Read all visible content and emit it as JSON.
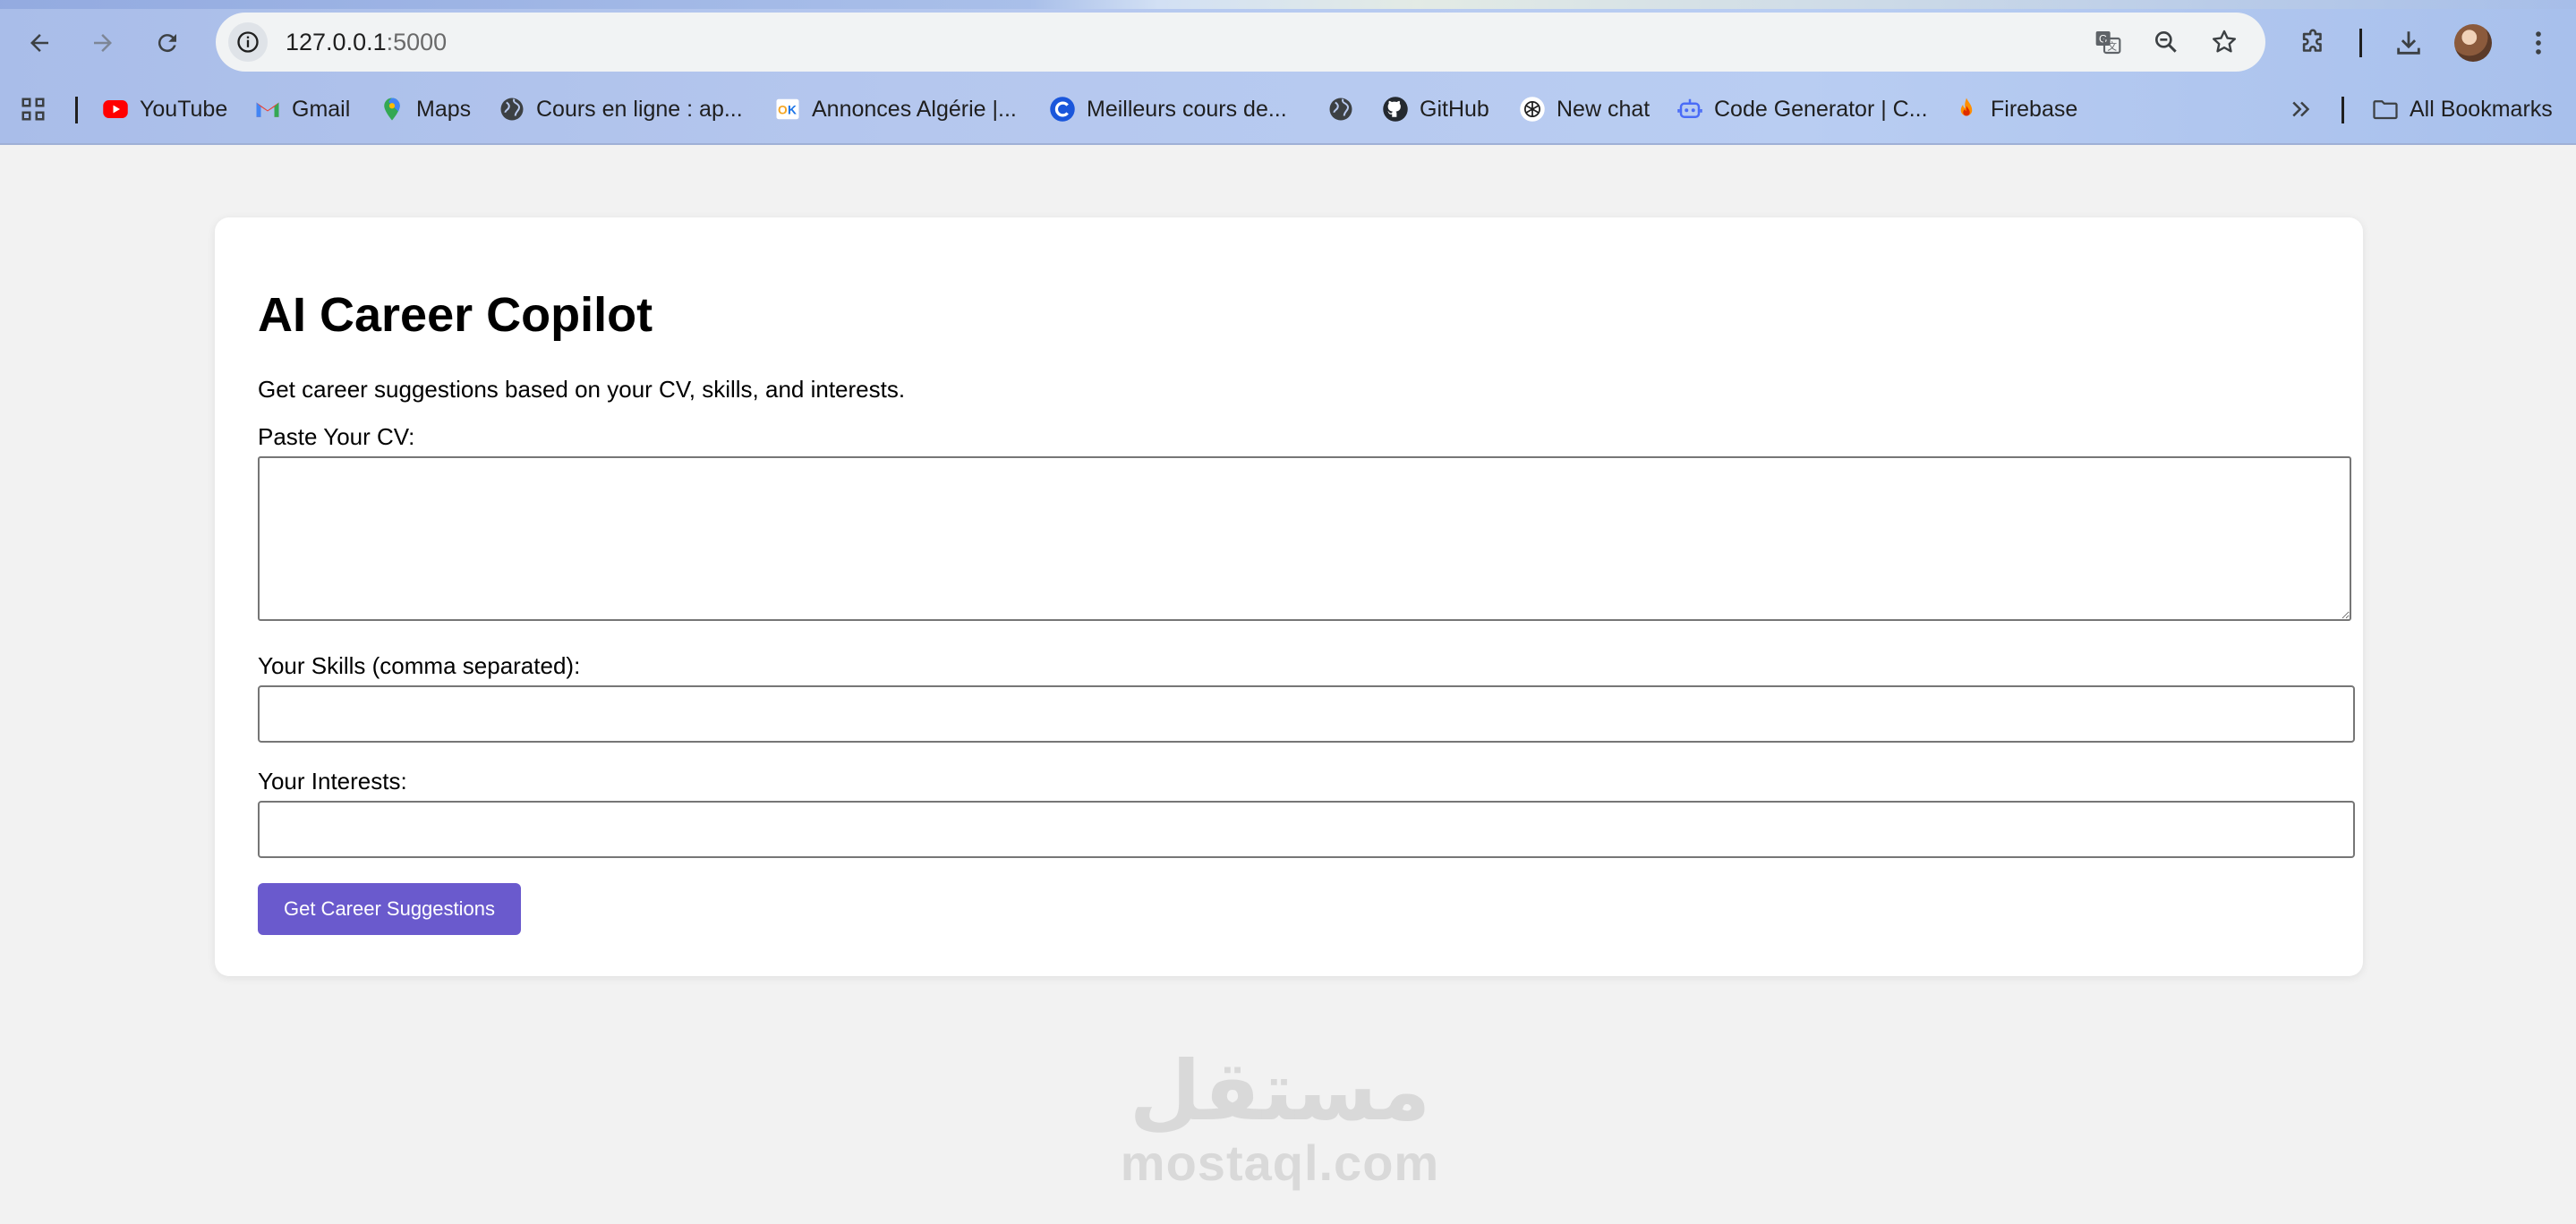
{
  "browser": {
    "url_host": "127.0.0.1",
    "url_port": ":5000",
    "bookmarks": [
      {
        "label": "YouTube",
        "icon": "youtube-icon",
        "color": "#ff0000"
      },
      {
        "label": "Gmail",
        "icon": "gmail-icon",
        "color": "#ea4335"
      },
      {
        "label": "Maps",
        "icon": "maps-icon",
        "color": "#34a853"
      },
      {
        "label": "Cours en ligne  : ap...",
        "icon": "globe-icon",
        "color": "#3c4043"
      },
      {
        "label": "Annonces Algérie |...",
        "icon": "ouedkniss-icon",
        "color": "#f5a623"
      },
      {
        "label": "Meilleurs cours de...",
        "icon": "coursera-icon",
        "color": "#1a56db"
      },
      {
        "label": "",
        "icon": "globe-icon",
        "color": "#3c4043"
      },
      {
        "label": "GitHub",
        "icon": "github-icon",
        "color": "#24292f"
      },
      {
        "label": "New chat",
        "icon": "openai-icon",
        "color": "#1f1f1f"
      },
      {
        "label": "Code Generator | C...",
        "icon": "robot-icon",
        "color": "#4a6cf7"
      },
      {
        "label": "Firebase",
        "icon": "firebase-icon",
        "color": "#ff8f00"
      }
    ],
    "all_bookmarks_label": "All Bookmarks"
  },
  "page": {
    "title": "AI Career Copilot",
    "subtitle": "Get career suggestions based on your CV, skills, and interests.",
    "cv_label": "Paste Your CV:",
    "cv_value": "",
    "skills_label": "Your Skills (comma separated):",
    "skills_value": "",
    "interests_label": "Your Interests:",
    "interests_value": "",
    "submit_label": "Get Career Suggestions",
    "accent_color": "#6a5acd"
  },
  "watermark": {
    "arabic": "مستقل",
    "latin": "mostaql.com"
  }
}
